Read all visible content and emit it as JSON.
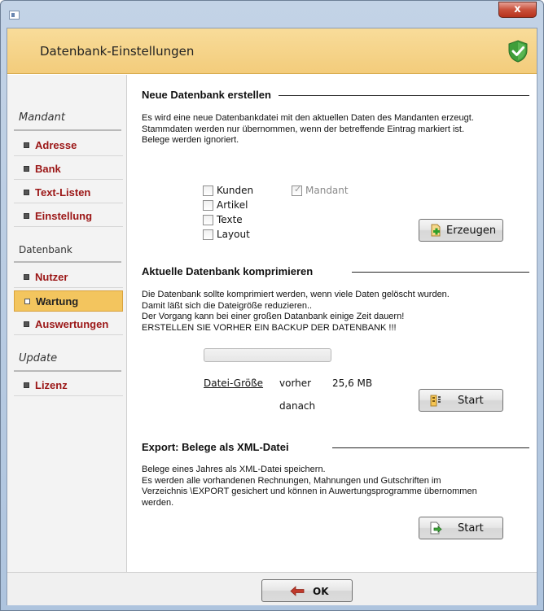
{
  "window": {
    "close_label": "x"
  },
  "header": {
    "title": "Datenbank-Einstellungen"
  },
  "sidebar": {
    "groups": [
      {
        "heading": "Mandant",
        "items": [
          "Adresse",
          "Bank",
          "Text-Listen",
          "Einstellung"
        ]
      },
      {
        "heading": "Datenbank",
        "items": [
          "Nutzer",
          "Wartung",
          "Auswertungen"
        ]
      },
      {
        "heading": "Update",
        "items": [
          "Lizenz"
        ]
      }
    ],
    "active_item": "Wartung"
  },
  "section_new": {
    "title": "Neue Datenbank erstellen",
    "lines": [
      "Es wird eine neue Datenbankdatei mit den aktuellen Daten des Mandanten erzeugt.",
      "Stammdaten werden nur übernommen, wenn der betreffende Eintrag markiert ist.",
      "Belege werden ignoriert."
    ],
    "checkboxes": [
      {
        "label": "Kunden",
        "checked": false,
        "enabled": true
      },
      {
        "label": "Artikel",
        "checked": false,
        "enabled": true
      },
      {
        "label": "Texte",
        "checked": false,
        "enabled": true
      },
      {
        "label": "Layout",
        "checked": false,
        "enabled": true
      },
      {
        "label": "Mandant",
        "checked": true,
        "enabled": false
      }
    ],
    "button_label": "Erzeugen"
  },
  "section_compress": {
    "title": "Aktuelle Datenbank komprimieren",
    "lines": [
      "Die Datenbank sollte komprimiert werden, wenn viele Daten gelöscht wurden.",
      "Damit läßt sich die Dateigröße reduzieren..",
      "Der Vorgang kann bei einer großen Datanbank einige Zeit dauern!",
      "ERSTELLEN SIE VORHER EIN BACKUP DER DATENBANK !!!"
    ],
    "progress": 0,
    "size_link": "Datei-Größe",
    "before_label": "vorher",
    "before_value": "25,6 MB",
    "after_label": "danach",
    "button_label": "Start"
  },
  "section_export": {
    "title": "Export:   Belege als XML-Datei",
    "lines": [
      "Belege eines Jahres als XML-Datei speichern.",
      "Es werden alle vorhandenen Rechnungen, Mahnungen und Gutschriften im",
      "Verzeichnis \\EXPORT gesichert und können in Auwertungsprogramme übernommen",
      "werden."
    ],
    "button_label": "Start"
  },
  "footer": {
    "ok_label": "OK"
  },
  "colors": {
    "header": "#f3cc7b",
    "active_item": "#f3c55e",
    "sidebar_link": "#9b1616"
  }
}
